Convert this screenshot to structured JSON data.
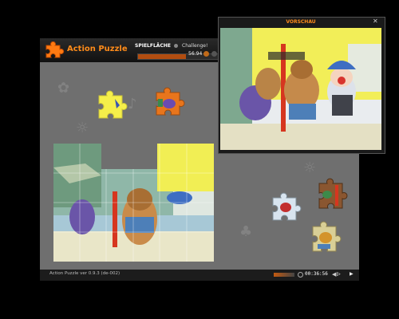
{
  "app": {
    "title": "Action Puzzle",
    "tabs": [
      {
        "label": "SPIELFLÄCHE"
      },
      {
        "label": "Challenge!"
      }
    ],
    "score": "56:94",
    "progress": 0.6
  },
  "preview": {
    "title": "VORSCHAU",
    "close": "✕"
  },
  "status": {
    "version": "Action Puzzle ver 0.9.3 (de-002)",
    "timer": "00:36:56",
    "sound": "◀ᐅ",
    "play": "▶"
  },
  "colors": {
    "brand": "#ff8c1a",
    "window_bg": "#6f6f6f",
    "titlebar": "#1a1a1a",
    "piece_yellow": "#f5ef4a",
    "piece_orange": "#e8751c"
  },
  "icons": [
    "puzzle-logo-icon",
    "clock-icon",
    "volume-icon",
    "sound-icon",
    "play-icon",
    "close-icon"
  ]
}
